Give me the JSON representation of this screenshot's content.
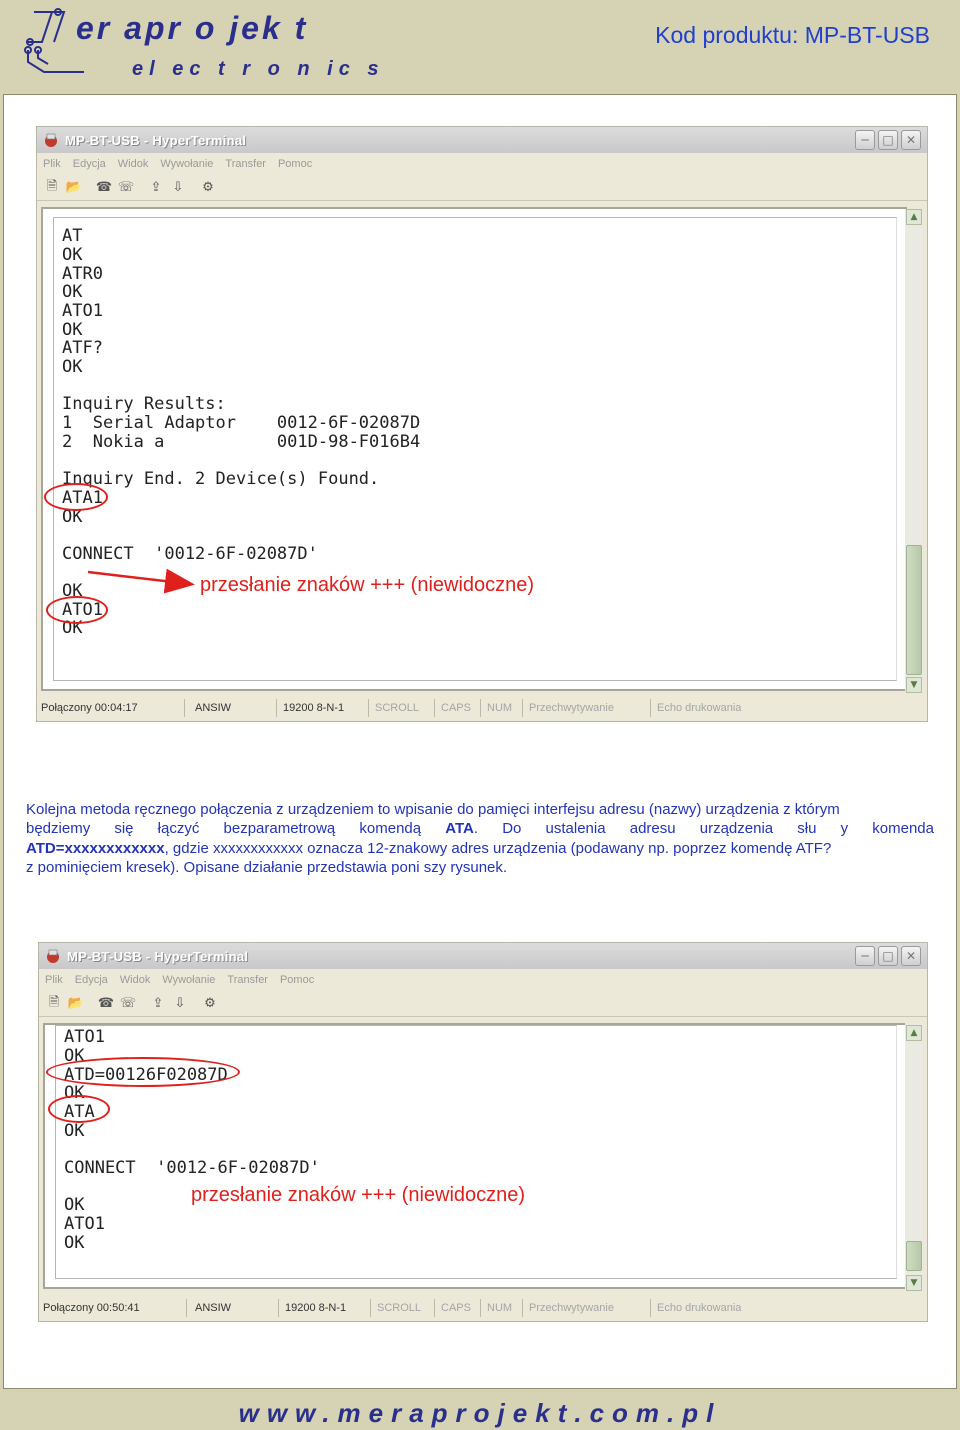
{
  "header": {
    "logo_main": "er apr o jek t",
    "logo_sub": "el ec t r o n ic s",
    "product_code": "Kod produktu: MP-BT-USB"
  },
  "window1": {
    "title": "MP-BT-USB - HyperTerminal",
    "menu": [
      "Plik",
      "Edycja",
      "Widok",
      "Wywołanie",
      "Transfer",
      "Pomoc"
    ],
    "terminal_lines": [
      "AT",
      "OK",
      "ATR0",
      "OK",
      "ATO1",
      "OK",
      "ATF?",
      "OK",
      "",
      "Inquiry Results:",
      "1  Serial Adaptor    0012-6F-02087D",
      "2  Nokia a           001D-98-F016B4",
      "",
      "Inquiry End. 2 Device(s) Found.",
      "ATA1",
      "OK",
      "",
      "CONNECT  '0012-6F-02087D'",
      "",
      "OK",
      "ATO1",
      "OK"
    ],
    "status": [
      "Połączony 00:04:17",
      "ANSIW",
      "19200 8-N-1",
      "SCROLL",
      "CAPS",
      "NUM",
      "Przechwytywanie",
      "Echo drukowania"
    ],
    "annotation": "przesłanie znaków +++ (niewidoczne)"
  },
  "paragraph": {
    "line1": "Kolejna metoda ręcznego połączenia z urządzeniem to wpisanie do pamięci interfejsu adresu (nazwy) urządzenia z którym",
    "line2_a": "będziemy się łączyć bezparametrową komendą ",
    "line2_b": "ATA",
    "line2_c": ". Do ustalenia adresu urządzenia słu y komenda",
    "line3_a": "ATD=xxxxxxxxxxxx",
    "line3_b": ", gdzie xxxxxxxxxxxx oznacza 12-znakowy adres urządzenia (podawany np. poprzez komendę ATF?",
    "line4": "z pominięciem kresek). Opisane działanie przedstawia poni  szy rysunek."
  },
  "window2": {
    "title": "MP-BT-USB - HyperTerminal",
    "menu": [
      "Plik",
      "Edycja",
      "Widok",
      "Wywołanie",
      "Transfer",
      "Pomoc"
    ],
    "terminal_lines": [
      "ATO1",
      "OK",
      "ATD=00126F02087D",
      "OK",
      "ATA",
      "OK",
      "",
      "CONNECT  '0012-6F-02087D'",
      "",
      "OK",
      "ATO1",
      "OK"
    ],
    "status": [
      "Połączony 00:50:41",
      "ANSIW",
      "19200 8-N-1",
      "SCROLL",
      "CAPS",
      "NUM",
      "Przechwytywanie",
      "Echo drukowania"
    ],
    "annotation": "przesłanie znaków +++ (niewidoczne)"
  },
  "footer": {
    "url": "www.meraprojekt.com.pl"
  },
  "colors": {
    "background": "#d5d3b3",
    "accent_blue": "#1f3fd0",
    "text_blue": "#2234b8",
    "annotation_red": "#e0201c"
  }
}
